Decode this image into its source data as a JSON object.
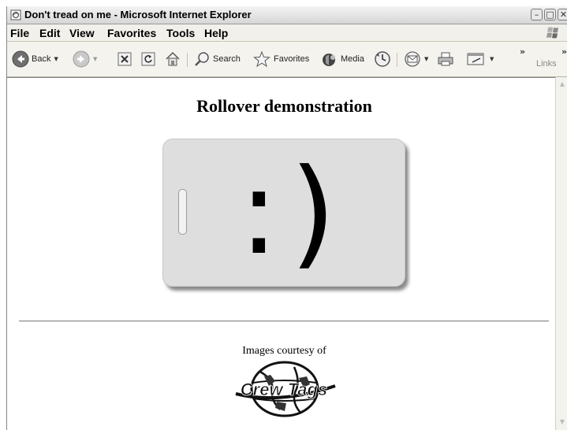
{
  "window": {
    "title": "Don't tread on me - Microsoft Internet Explorer",
    "min_label": "–",
    "max_label": "□",
    "close_label": "✕"
  },
  "menu": {
    "items": [
      "File",
      "Edit",
      "View",
      "Favorites",
      "Tools",
      "Help"
    ]
  },
  "toolbar": {
    "back_label": "Back",
    "search_label": "Search",
    "favorites_label": "Favorites",
    "media_label": "Media",
    "overflow_label": "»",
    "links_label": "Links",
    "links_overflow_label": "»"
  },
  "page": {
    "heading": "Rollover demonstration",
    "face_text": ":)",
    "courtesy_text": "Images courtesy of",
    "logo_text": "Crew Tags"
  },
  "colors": {
    "titlebar": "#dcdcdc",
    "chrome": "#f4f3ee",
    "content_bg": "#ffffff",
    "tag_fill": "#dedede"
  }
}
